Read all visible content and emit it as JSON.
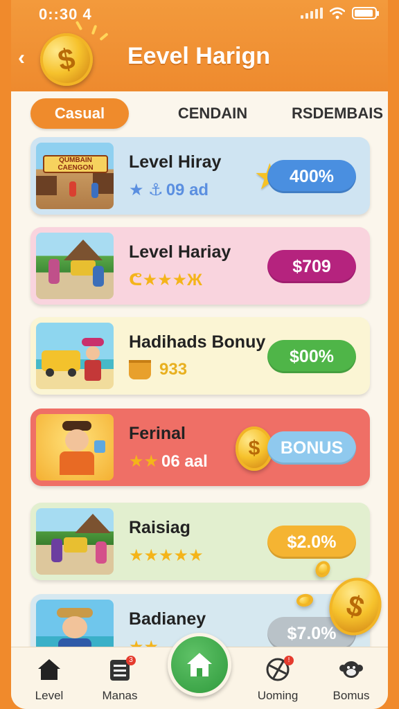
{
  "status": {
    "time": "0::30 4"
  },
  "header": {
    "title": "Eevel Harign",
    "coin_symbol": "$"
  },
  "tabs": [
    {
      "label": "Casual",
      "active": true
    },
    {
      "label": "CENDAIN",
      "active": false
    },
    {
      "label": "RSDEMBAIS",
      "active": false
    }
  ],
  "cards": [
    {
      "name": "Level Hiray",
      "meta_text": "09 ad",
      "stars": "★ ⚓",
      "reward": "400%",
      "card_color": "#cfe4f2",
      "pill_color": "#4a8fe0",
      "thumb_text": "QUMBAIN CAENGON"
    },
    {
      "name": "Level Hariay",
      "meta_text": "",
      "stars": "ᕦ★★★Ж",
      "reward": "$709",
      "card_color": "#f9d4de",
      "pill_color": "#b5237e"
    },
    {
      "name": "Hadihads Bonuy",
      "meta_text": "933",
      "stars": "",
      "reward": "$00%",
      "card_color": "#fbf5d4",
      "pill_color": "#4fb548"
    },
    {
      "name": "Ferinal",
      "meta_text": "06 aal",
      "stars": "★★",
      "reward": "BONUS",
      "card_color": "#ef6f66",
      "pill_color": "#8fc9ee"
    },
    {
      "name": "Raisiag",
      "meta_text": "",
      "stars": "★★★★★",
      "reward": "$2.0%",
      "card_color": "#e2efcf",
      "pill_color": "#f5b432"
    },
    {
      "name": "Badianey",
      "meta_text": "",
      "stars": "★★",
      "reward": "$7.0%",
      "card_color": "#d6e8f0",
      "pill_color": "#b9c2c8"
    }
  ],
  "nav": [
    {
      "label": "Level"
    },
    {
      "label": "Manas",
      "badge": "3"
    },
    {
      "label": "Uoming",
      "badge": "!"
    },
    {
      "label": "Bomus"
    }
  ]
}
